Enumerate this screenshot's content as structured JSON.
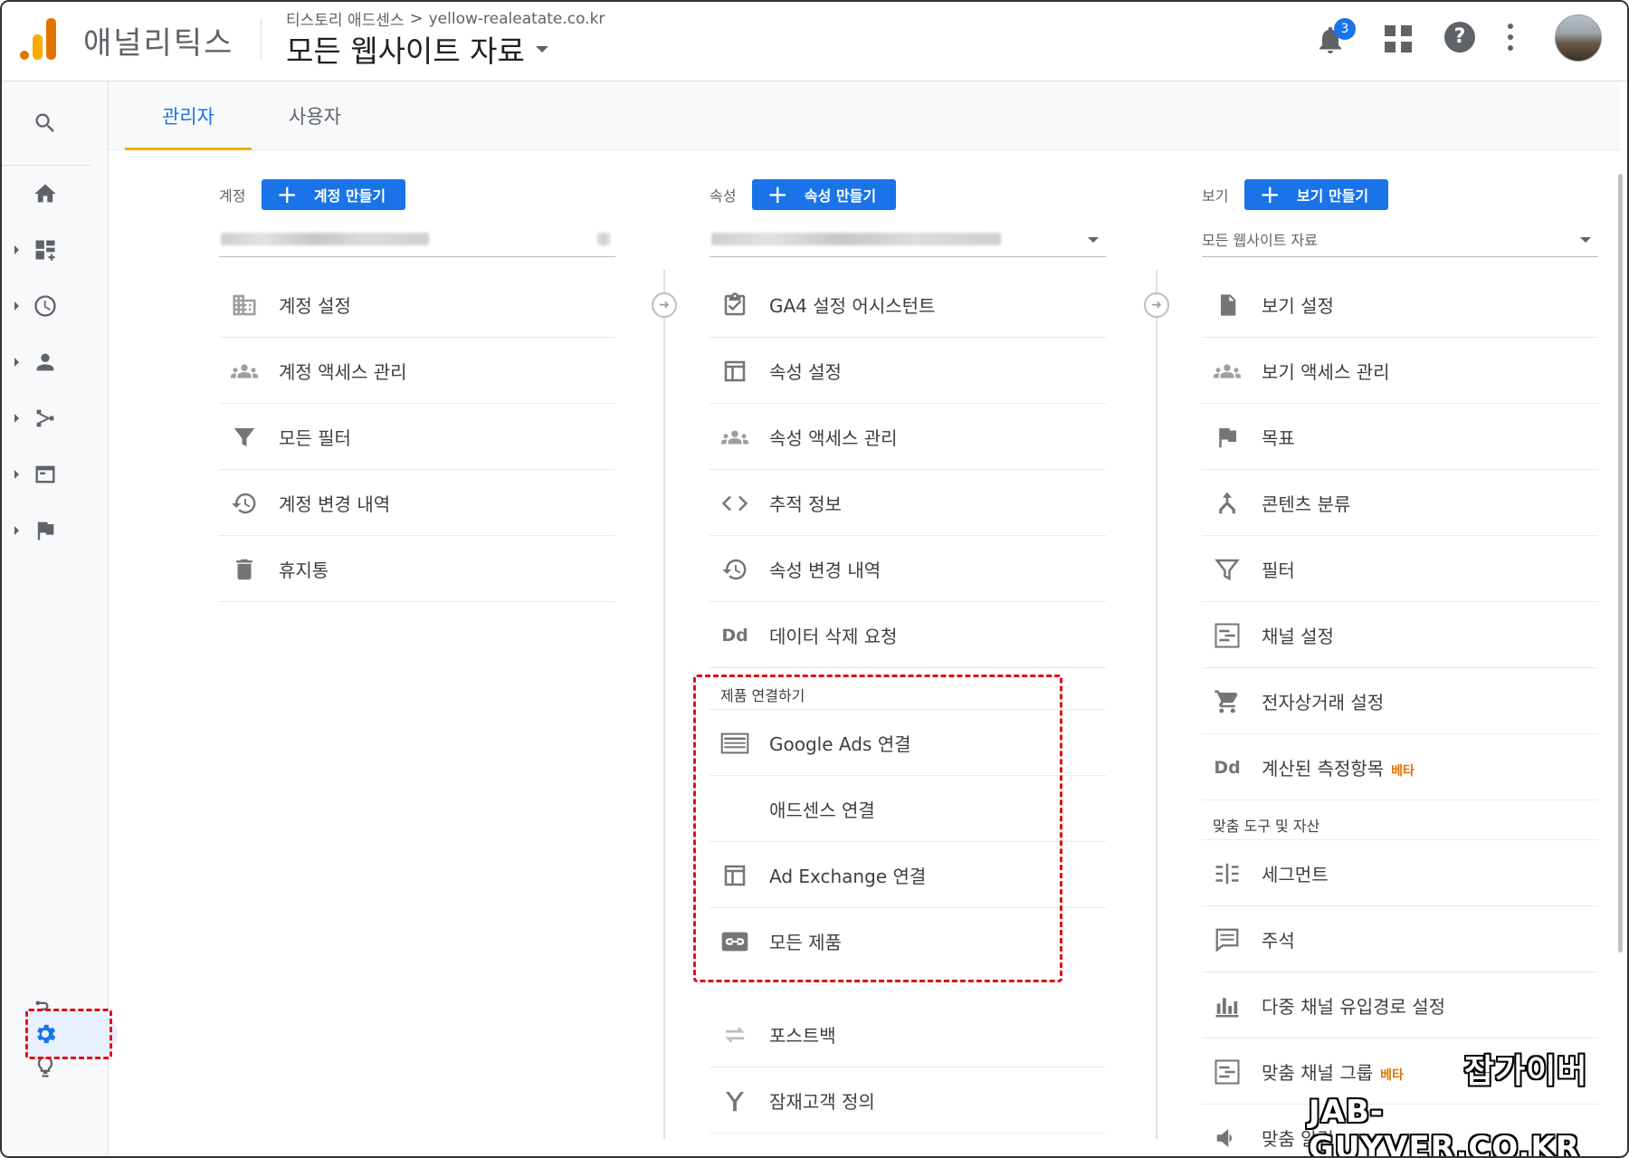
{
  "header": {
    "app_name": "애널리틱스",
    "breadcrumb_account": "티스토리 애드센스",
    "breadcrumb_sep": ">",
    "breadcrumb_property": "yellow-realeatate.co.kr",
    "view_title": "모든 웹사이트 자료",
    "notification_count": "3",
    "help_glyph": "?"
  },
  "tabs": [
    {
      "label": "관리자",
      "active": true
    },
    {
      "label": "사용자",
      "active": false
    }
  ],
  "rail": {
    "items": [
      "search-icon",
      "home-icon",
      "customization-icon",
      "realtime-icon",
      "audience-icon",
      "acquisition-icon",
      "behavior-icon",
      "conversions-icon",
      "attribution-icon",
      "discover-icon",
      "admin-gear-icon"
    ]
  },
  "account": {
    "label": "계정",
    "create_label": "계정 만들기",
    "items": [
      {
        "icon": "building-icon",
        "label": "계정 설정"
      },
      {
        "icon": "people-icon",
        "label": "계정 액세스 관리"
      },
      {
        "icon": "filter-icon",
        "label": "모든 필터"
      },
      {
        "icon": "history-icon",
        "label": "계정 변경 내역"
      },
      {
        "icon": "trash-icon",
        "label": "휴지통"
      }
    ]
  },
  "property": {
    "label": "속성",
    "create_label": "속성 만들기",
    "items": [
      {
        "icon": "checklist-icon",
        "label": "GA4 설정 어시스턴트"
      },
      {
        "icon": "window-icon",
        "label": "속성 설정"
      },
      {
        "icon": "people-icon",
        "label": "속성 액세스 관리"
      },
      {
        "icon": "code-icon",
        "label": "추적 정보"
      },
      {
        "icon": "history-icon",
        "label": "속성 변경 내역"
      },
      {
        "icon": "dd-icon",
        "label": "데이터 삭제 요청",
        "glyph": "Dd"
      }
    ],
    "linking_title": "제품 연결하기",
    "linking_items": [
      {
        "icon": "ads-icon",
        "label": "Google Ads 연결"
      },
      {
        "icon": "adsense-icon",
        "label": "애드센스 연결"
      },
      {
        "icon": "window-icon",
        "label": "Ad Exchange 연결"
      },
      {
        "icon": "link-icon",
        "label": "모든 제품"
      }
    ],
    "more_items": [
      {
        "icon": "postback-icon",
        "label": "포스트백"
      },
      {
        "icon": "audience-def-icon",
        "label": "잠재고객 정의"
      }
    ]
  },
  "view": {
    "label": "보기",
    "create_label": "보기 만들기",
    "selected": "모든 웹사이트 자료",
    "items": [
      {
        "icon": "document-icon",
        "label": "보기 설정"
      },
      {
        "icon": "people-icon",
        "label": "보기 액세스 관리"
      },
      {
        "icon": "flag-icon",
        "label": "목표"
      },
      {
        "icon": "grouping-icon",
        "label": "콘텐츠 분류"
      },
      {
        "icon": "filter-icon",
        "label": "필터"
      },
      {
        "icon": "channel-icon",
        "label": "채널 설정"
      },
      {
        "icon": "cart-icon",
        "label": "전자상거래 설정"
      },
      {
        "icon": "dd-icon",
        "label": "계산된 측정항목",
        "glyph": "Dd",
        "badge": "베타"
      }
    ],
    "tools_title": "맞춤 도구 및 자산",
    "tools_items": [
      {
        "icon": "segment-icon",
        "label": "세그먼트"
      },
      {
        "icon": "annotation-icon",
        "label": "주석"
      },
      {
        "icon": "bar-chart-icon",
        "label": "다중 채널 유입경로 설정"
      },
      {
        "icon": "channel-icon",
        "label": "맞춤 채널 그룹",
        "badge": "베타"
      },
      {
        "icon": "megaphone-icon",
        "label": "맞춤 알림"
      }
    ]
  },
  "watermark": {
    "line1": "잡가이버",
    "line2": "JAB-GUYVER.CO.KR"
  }
}
